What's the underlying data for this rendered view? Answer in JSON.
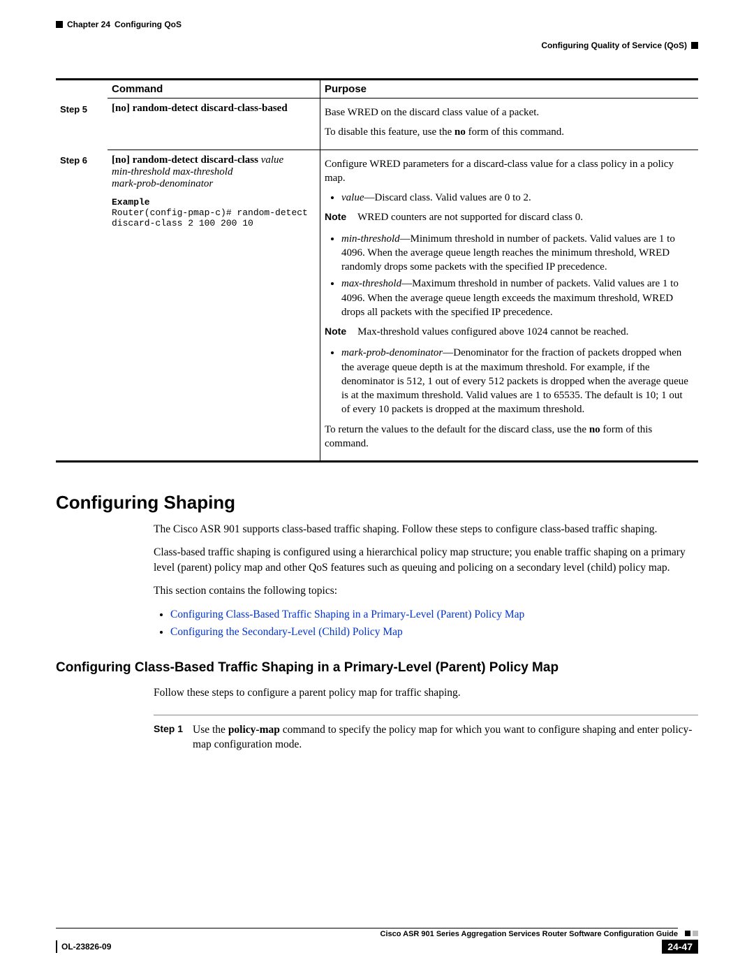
{
  "header": {
    "chapter_label": "Chapter 24",
    "chapter_title": "Configuring QoS",
    "section_header": "Configuring Quality of Service (QoS)"
  },
  "table": {
    "head_command": "Command",
    "head_purpose": "Purpose",
    "row5": {
      "step": "Step 5",
      "cmd_no": "[no]",
      "cmd_rest": " random-detect discard-class-based",
      "purpose_p1": "Base WRED on the discard class value of a packet.",
      "purpose_p2a": "To disable this feature, use the ",
      "purpose_p2b": "no",
      "purpose_p2c": " form of this command."
    },
    "row6": {
      "step": "Step 6",
      "cmd_no": "[no]",
      "cmd_bold": " random-detect discard-class",
      "cmd_i_value": " value",
      "cmd_i_line2": "min-threshold max-threshold",
      "cmd_i_line3": "mark-prob-denominator",
      "example_label": "Example",
      "example_code": "Router(config-pmap-c)# random-detect\ndiscard-class 2 100 200 10",
      "p_intro": "Configure WRED parameters for a discard-class value for a class policy in a policy map.",
      "b1_i": "value",
      "b1_t": "—Discard class. Valid values are 0 to 2.",
      "note1_label": "Note",
      "note1_text": "WRED counters are not supported for discard class 0.",
      "b2_i": "min-threshold",
      "b2_t": "—Minimum threshold in number of packets. Valid values are 1 to 4096. When the average queue length reaches the minimum threshold, WRED randomly drops some packets with the specified IP precedence.",
      "b3_i": "max-threshold",
      "b3_t": "—Maximum threshold in number of packets. Valid values are 1 to 4096. When the average queue length exceeds the maximum threshold, WRED drops all packets with the specified IP precedence.",
      "note2_label": "Note",
      "note2_text": "Max-threshold values configured above 1024 cannot be reached.",
      "b4_i": "mark-prob-denominator",
      "b4_t": "—Denominator for the fraction of packets dropped when the average queue depth is at the maximum threshold. For example, if the denominator is 512, 1 out of every 512 packets is dropped when the average queue is at the maximum threshold. Valid values are 1 to 65535. The default is 10; 1 out of every 10 packets is dropped at the maximum threshold.",
      "p_out_a": "To return the values to the default for the discard class, use the ",
      "p_out_b": "no",
      "p_out_c": " form of this command."
    }
  },
  "shaping": {
    "h1": "Configuring Shaping",
    "p1": "The Cisco ASR 901 supports class-based traffic shaping. Follow these steps to configure class-based traffic shaping.",
    "p2": "Class-based traffic shaping is configured using a hierarchical policy map structure; you enable traffic shaping on a primary level (parent) policy map and other QoS features such as queuing and policing on a secondary level (child) policy map.",
    "p3": "This section contains the following topics:",
    "link1": "Configuring Class-Based Traffic Shaping in a Primary-Level (Parent) Policy Map",
    "link2": "Configuring the Secondary-Level (Child) Policy Map",
    "h2": "Configuring Class-Based Traffic Shaping in a Primary-Level (Parent) Policy Map",
    "p4": "Follow these steps to configure a parent policy map for traffic shaping.",
    "step1_label": "Step 1",
    "step1_a": "Use the ",
    "step1_b": "policy-map",
    "step1_c": " command to specify the policy map for which you want to configure shaping and enter policy-map configuration mode."
  },
  "footer": {
    "guide": "Cisco ASR 901 Series Aggregation Services Router Software Configuration Guide",
    "docid": "OL-23826-09",
    "page": "24-47"
  }
}
